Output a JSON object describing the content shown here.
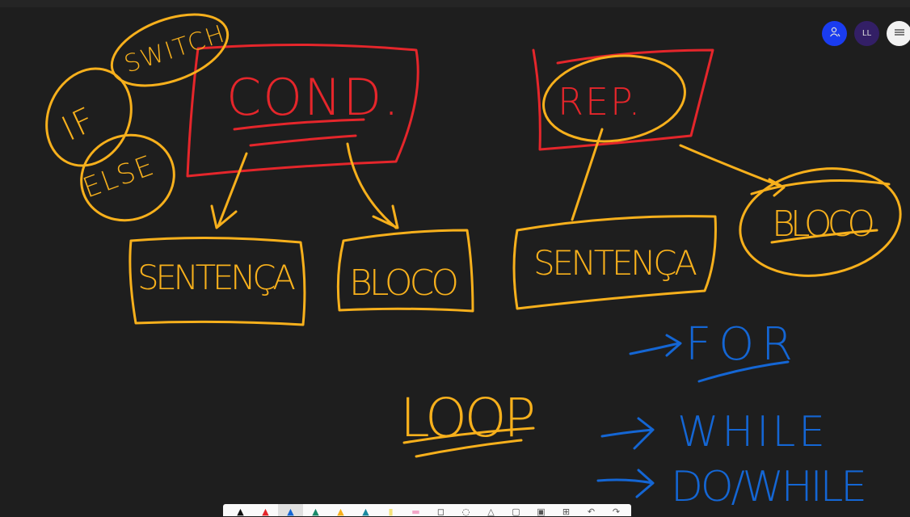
{
  "colors": {
    "background": "#1e1e1e",
    "red": "#e5262b",
    "orange": "#f7b01c",
    "blue": "#1466d4"
  },
  "board": {
    "words": {
      "cond": "COND.",
      "switch": "SWITCH",
      "if": "IF",
      "else": "ELSE",
      "sentenca1": "SENTENÇA",
      "bloco1": "BLOCO",
      "rep": "REP.",
      "sentenca2": "SENTENÇA",
      "bloco2": "BLOCO",
      "loop": "LOOP",
      "for": "FOR",
      "while": "WHILE",
      "dowhile": "DO/WHILE"
    }
  },
  "header": {
    "invite_icon": "person-add-icon",
    "user_initials": "LL",
    "menu_icon": "hamburger-menu-icon"
  },
  "toolbar": {
    "tools": [
      {
        "name": "pen-black",
        "glyph": "▲",
        "color": "#111111"
      },
      {
        "name": "pen-red",
        "glyph": "▲",
        "color": "#e5262b"
      },
      {
        "name": "pen-blue",
        "glyph": "▲",
        "color": "#1466d4",
        "active": true
      },
      {
        "name": "pen-green",
        "glyph": "▲",
        "color": "#1a8a6a"
      },
      {
        "name": "pen-orange",
        "glyph": "▲",
        "color": "#f7b01c"
      },
      {
        "name": "pen-teal",
        "glyph": "▲",
        "color": "#1a8aa0"
      },
      {
        "name": "highlighter",
        "glyph": "▮",
        "color": "#f4e27a"
      },
      {
        "name": "eraser",
        "glyph": "▬",
        "color": "#f2a6c8"
      },
      {
        "name": "ruler",
        "glyph": "◻",
        "color": "#333333"
      },
      {
        "name": "lasso",
        "glyph": "◌",
        "color": "#333333"
      },
      {
        "name": "shapes",
        "glyph": "△",
        "color": "#555555"
      },
      {
        "name": "note",
        "glyph": "▢",
        "color": "#555555"
      },
      {
        "name": "image",
        "glyph": "▣",
        "color": "#555555"
      },
      {
        "name": "insert",
        "glyph": "⊞",
        "color": "#555555"
      },
      {
        "name": "undo",
        "glyph": "↶",
        "color": "#555555"
      },
      {
        "name": "redo",
        "glyph": "↷",
        "color": "#555555"
      }
    ]
  }
}
